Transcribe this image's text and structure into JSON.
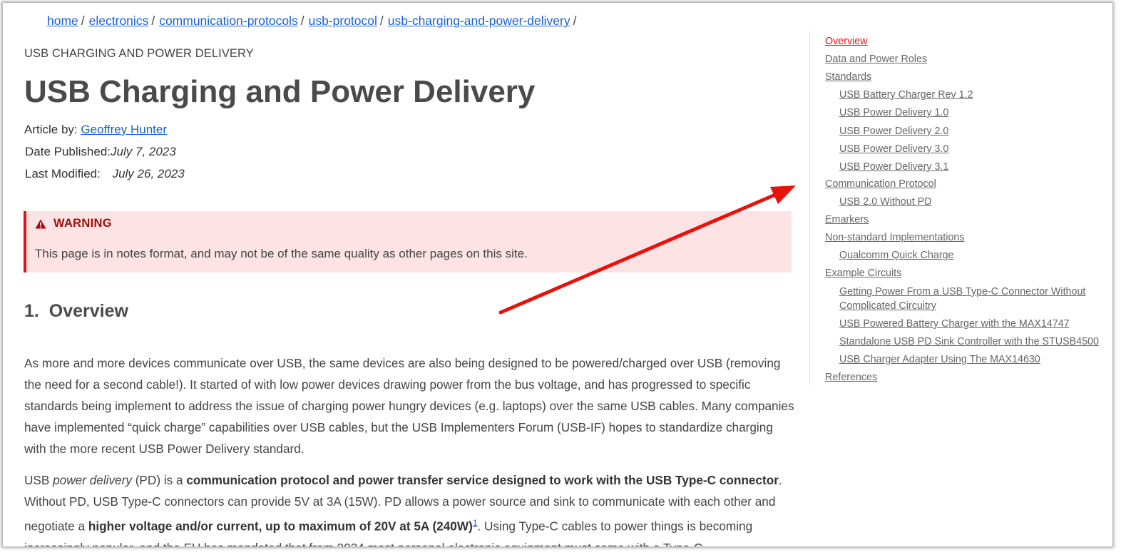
{
  "breadcrumb": {
    "items": [
      "home",
      "electronics",
      "communication-protocols",
      "usb-protocol",
      "usb-charging-and-power-delivery"
    ],
    "separator": "/"
  },
  "article": {
    "supertitle": "USB CHARGING AND POWER DELIVERY",
    "title": "USB Charging and Power Delivery",
    "author_label": "Article by:",
    "author": "Geoffrey Hunter",
    "published_label": "Date Published:",
    "published": "July 7, 2023",
    "modified_label": "Last Modified:",
    "modified": "July 26, 2023"
  },
  "warning": {
    "icon": "warning-triangle-icon",
    "heading": "WARNING",
    "text": "This page is in notes format, and may not be of the same quality as other pages on this site."
  },
  "section": {
    "number": "1.",
    "heading": "Overview"
  },
  "paragraph1": "As more and more devices communicate over USB, the same devices are also being designed to be powered/charged over USB (removing the need for a second cable!). It started of with low power devices drawing power from the bus voltage, and has progressed to specific standards being implement to address the issue of charging power hungry devices (e.g. laptops) over the same USB cables. Many companies have implemented “quick charge” capabilities over USB cables, but the USB Implementers Forum (USB-IF) hopes to standardize charging with the more recent USB Power Delivery standard.",
  "paragraph2": {
    "p1": "USB ",
    "p2": "power delivery",
    "p3": " (PD) is a ",
    "p4": "communication protocol and power transfer service designed to work with the USB Type-C connector",
    "p5": ". Without PD, USB Type-C connectors can provide 5V at 3A (15W). PD allows a power source and sink to communicate with each other and negotiate a ",
    "p6": "higher voltage and/or current, up to maximum of 20V at 5A (240W)",
    "footnote": "1",
    "p7": ". Using Type-C cables to power things is becoming increasingly popular, and the EU has mandated that from 2024 most personal electronic equipment must come with a Type-C"
  },
  "toc": {
    "items": [
      {
        "label": "Overview",
        "level": 1,
        "active": true
      },
      {
        "label": "Data and Power Roles",
        "level": 1
      },
      {
        "label": "Standards",
        "level": 1
      },
      {
        "label": "USB Battery Charger Rev 1.2",
        "level": 2
      },
      {
        "label": "USB Power Delivery 1.0",
        "level": 2
      },
      {
        "label": "USB Power Delivery 2.0",
        "level": 2
      },
      {
        "label": "USB Power Delivery 3.0",
        "level": 2
      },
      {
        "label": "USB Power Delivery 3.1",
        "level": 2
      },
      {
        "label": "Communication Protocol",
        "level": 1
      },
      {
        "label": "USB 2.0 Without PD",
        "level": 2
      },
      {
        "label": "Emarkers",
        "level": 1
      },
      {
        "label": "Non-standard Implementations",
        "level": 1
      },
      {
        "label": "Qualcomm Quick Charge",
        "level": 2
      },
      {
        "label": "Example Circuits",
        "level": 1
      },
      {
        "label": "Getting Power From a USB Type-C Connector Without",
        "level": 2
      },
      {
        "label": "Complicated Circuitry",
        "level": 2
      },
      {
        "label": "USB Powered Battery Charger with the MAX14747",
        "level": 2
      },
      {
        "label": "Standalone USB PD Sink Controller with the STUSB4500",
        "level": 2
      },
      {
        "label": "USB Charger Adapter Using The MAX14630",
        "level": 2
      },
      {
        "label": "References",
        "level": 1
      }
    ]
  },
  "colors": {
    "link": "#1a5fd6",
    "accent_red": "#e3131b",
    "warning_bg": "#fde3e3",
    "annotation_arrow": "#e8120c"
  }
}
